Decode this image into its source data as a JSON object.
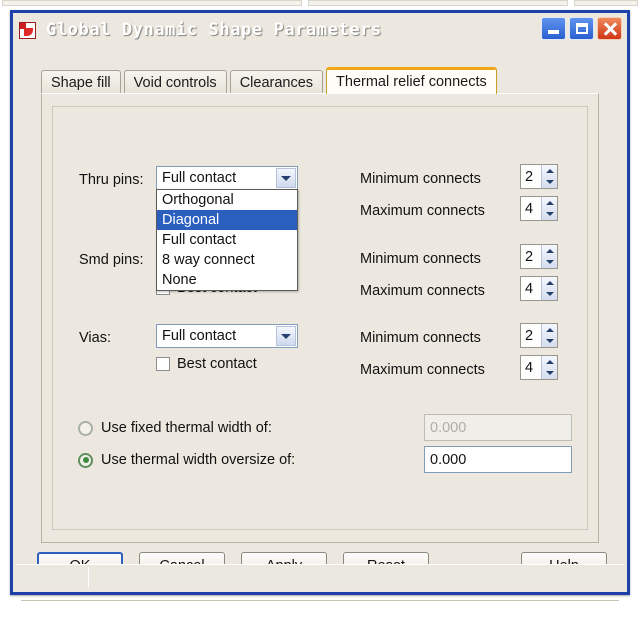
{
  "window": {
    "title": "Global Dynamic Shape Parameters",
    "icon": "app-icon",
    "controls": {
      "minimize": "minimize-button",
      "maximize": "maximize-button",
      "close": "close-button"
    }
  },
  "tabs": [
    {
      "label": "Shape fill",
      "active": false
    },
    {
      "label": "Void controls",
      "active": false
    },
    {
      "label": "Clearances",
      "active": false
    },
    {
      "label": "Thermal relief connects",
      "active": true
    }
  ],
  "rows": {
    "thru_pins": {
      "label": "Thru pins:",
      "combo_value": "Full contact",
      "minimum_label": "Minimum connects",
      "minimum_value": "2",
      "maximum_label": "Maximum connects",
      "maximum_value": "4"
    },
    "smd_pins": {
      "label": "Smd pins:",
      "checkbox_label": "Best contact",
      "minimum_label": "Minimum connects",
      "minimum_value": "2",
      "maximum_label": "Maximum connects",
      "maximum_value": "4"
    },
    "vias": {
      "label": "Vias:",
      "combo_value": "Full contact",
      "checkbox_label": "Best contact",
      "minimum_label": "Minimum connects",
      "minimum_value": "2",
      "maximum_label": "Maximum connects",
      "maximum_value": "4"
    }
  },
  "dropdown": {
    "open": true,
    "options": [
      {
        "label": "Orthogonal",
        "selected": false
      },
      {
        "label": "Diagonal",
        "selected": true
      },
      {
        "label": "Full contact",
        "selected": false
      },
      {
        "label": "8 way connect",
        "selected": false
      },
      {
        "label": "None",
        "selected": false
      }
    ],
    "highlight_color": "#2a5fc0"
  },
  "thermal_width": {
    "fixed": {
      "label": "Use fixed thermal width of:",
      "selected": false,
      "value": "0.000",
      "disabled": true
    },
    "oversize": {
      "label": "Use thermal width oversize of:",
      "selected": true,
      "value": "0.000",
      "disabled": false
    }
  },
  "buttons": {
    "ok": "OK",
    "cancel": "Cancel",
    "apply": "Apply",
    "reset": "Reset",
    "help": "Help"
  },
  "colors": {
    "dialog_background": "#ece8df",
    "title_blue": "#1d54c8",
    "active_tab_accent": "#f0a818",
    "radio_selected": "#3f8b3f"
  }
}
